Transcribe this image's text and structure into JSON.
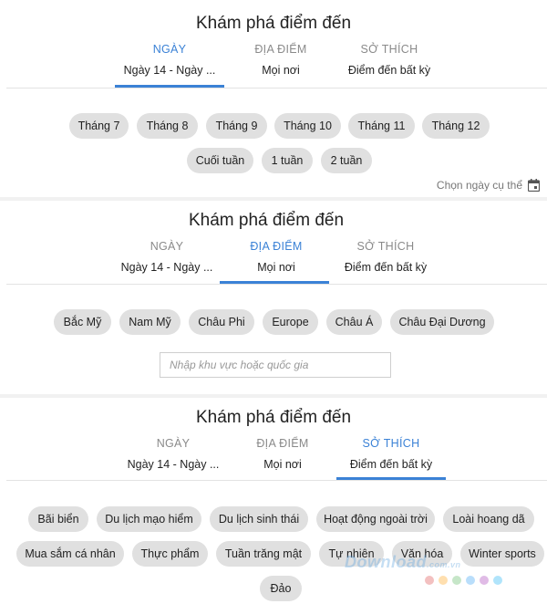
{
  "panels": [
    {
      "title": "Khám phá điểm đến",
      "tabs": [
        {
          "label": "NGÀY",
          "value": "Ngày 14 - Ngày ..."
        },
        {
          "label": "ĐỊA ĐIỂM",
          "value": "Mọi nơi"
        },
        {
          "label": "SỞ THÍCH",
          "value": "Điểm đến bất kỳ"
        }
      ],
      "active_tab": 0,
      "chips_row1": [
        "Tháng 7",
        "Tháng 8",
        "Tháng 9",
        "Tháng 10",
        "Tháng 11",
        "Tháng 12"
      ],
      "chips_row2": [
        "Cuối tuần",
        "1 tuần",
        "2 tuần"
      ],
      "specific_date_label": "Chọn ngày cụ thể",
      "specific_date_icon": "calendar-icon"
    },
    {
      "title": "Khám phá điểm đến",
      "tabs": [
        {
          "label": "NGÀY",
          "value": "Ngày 14 - Ngày ..."
        },
        {
          "label": "ĐỊA ĐIỂM",
          "value": "Mọi nơi"
        },
        {
          "label": "SỞ THÍCH",
          "value": "Điểm đến bất kỳ"
        }
      ],
      "active_tab": 1,
      "chips_row1": [
        "Bắc Mỹ",
        "Nam Mỹ",
        "Châu Phi",
        "Europe",
        "Châu Á",
        "Châu Đại Dương"
      ],
      "search_placeholder": "Nhập khu vực hoặc quốc gia"
    },
    {
      "title": "Khám phá điểm đến",
      "tabs": [
        {
          "label": "NGÀY",
          "value": "Ngày 14 - Ngày ..."
        },
        {
          "label": "ĐỊA ĐIỂM",
          "value": "Mọi nơi"
        },
        {
          "label": "SỞ THÍCH",
          "value": "Điểm đến bất kỳ"
        }
      ],
      "active_tab": 2,
      "chips_row1": [
        "Bãi biển",
        "Du lịch mạo hiểm",
        "Du lịch sinh thái",
        "Hoạt động ngoài trời",
        "Loài hoang dã"
      ],
      "chips_row2": [
        "Mua sắm cá nhân",
        "Thực phẩm",
        "Tuần trăng mật",
        "Tự nhiên",
        "Văn hóa",
        "Winter sports"
      ],
      "chips_row3": [
        "Đảo"
      ]
    }
  ],
  "colors": {
    "accent": "#3b82d6",
    "chip_bg": "#e0e0e0",
    "muted": "#8a8a8a"
  },
  "watermark": {
    "text": "Download",
    "suffix": ".com.vn",
    "dot_colors": [
      "#e57373",
      "#ffb74d",
      "#81c784",
      "#64b5f6",
      "#ba68c8",
      "#4fc3f7"
    ]
  }
}
